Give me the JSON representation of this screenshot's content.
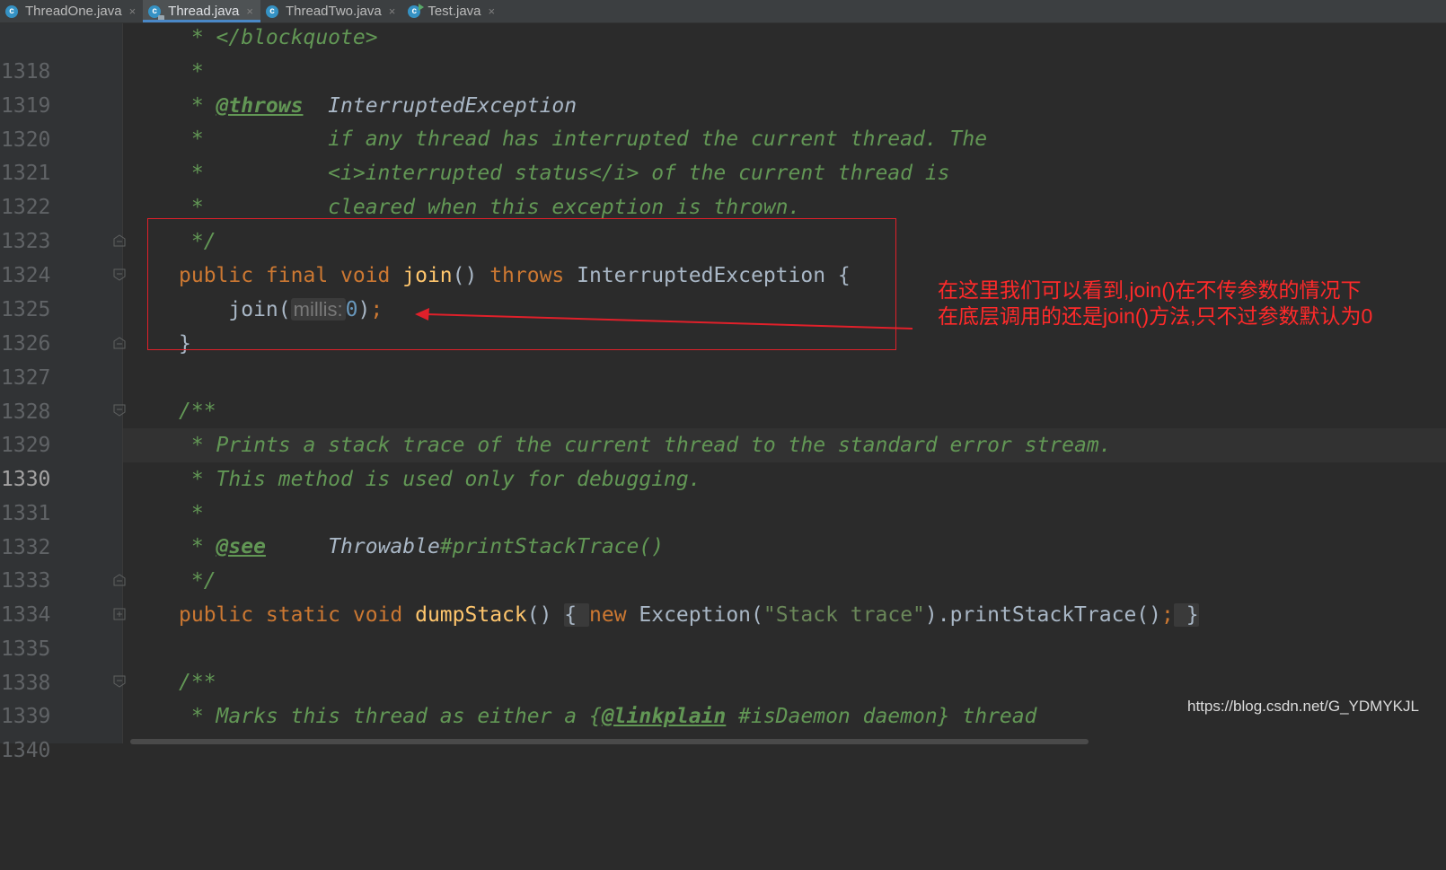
{
  "tabs": [
    {
      "label": "ThreadOne.java",
      "icon": "java-class-icon",
      "active": false
    },
    {
      "label": "Thread.java",
      "icon": "java-class-locked-icon",
      "active": true
    },
    {
      "label": "ThreadTwo.java",
      "icon": "java-class-icon",
      "active": false
    },
    {
      "label": "Test.java",
      "icon": "java-class-runnable-icon",
      "active": false
    }
  ],
  "tab_close_glyph": "×",
  "line_numbers": [
    "1318",
    "1319",
    "1320",
    "1321",
    "1322",
    "1323",
    "1324",
    "1325",
    "1326",
    "1327",
    "1328",
    "1329",
    "1330",
    "1331",
    "1332",
    "1333",
    "1334",
    "1335",
    "1338",
    "1339",
    "1340"
  ],
  "current_line": "1330",
  "code": {
    "l1318": " * </blockquote>",
    "l1319": " *",
    "l1320_star": " * ",
    "l1320_tag": "@throws",
    "l1320_rest": "  InterruptedException",
    "l1321": " *          if any thread has interrupted the current thread. The",
    "l1322": " *          <i>interrupted status</i> of the current thread is",
    "l1323": " *          cleared when this exception is thrown.",
    "l1324": " */",
    "l1325_kw": "public final void ",
    "l1325_fn": "join",
    "l1325_mid": "() ",
    "l1325_throws": "throws",
    "l1325_rest": " InterruptedException {",
    "l1326_call": "    join(",
    "l1326_hint": "millis:",
    "l1326_num": "0",
    "l1326_end": ")",
    "l1326_semi": ";",
    "l1327": "}",
    "l1329": "/**",
    "l1330": " * Prints a stack trace of the current thread to the standard error stream.",
    "l1331": " * This method is used only for debugging.",
    "l1332": " *",
    "l1333_star": " * ",
    "l1333_tag": "@see",
    "l1333_pad": "     ",
    "l1333_ref": "Throwable",
    "l1333_rest": "#printStackTrace()",
    "l1334": " */",
    "l1335_kw": "public static void ",
    "l1335_fn": "dumpStack",
    "l1335_paren": "()",
    "l1335_open": "{ ",
    "l1335_new": "new",
    "l1335_cls": " Exception(",
    "l1335_str": "\"Stack trace\"",
    "l1335_call": ").printStackTrace()",
    "l1335_semi": ";",
    "l1335_close": " }",
    "l1339": "/**",
    "l1340_pre": " * Marks this thread as either a {",
    "l1340_tag": "@linkplain",
    "l1340_rest": " #isDaemon daemon} thread"
  },
  "annotation": {
    "line1": "在这里我们可以看到,join()在不传参数的情况下",
    "line2": "在底层调用的还是join()方法,只不过参数默认为0",
    "color": "#ff2a2a"
  },
  "watermark": "https://blog.csdn.net/G_YDMYKJL",
  "colors": {
    "background": "#2b2b2b",
    "keyword": "#cc7832",
    "method": "#ffc66d",
    "javadoc": "#629755",
    "number": "#6897bb",
    "string": "#6a8759",
    "active_tab_underline": "#4a88c7"
  }
}
